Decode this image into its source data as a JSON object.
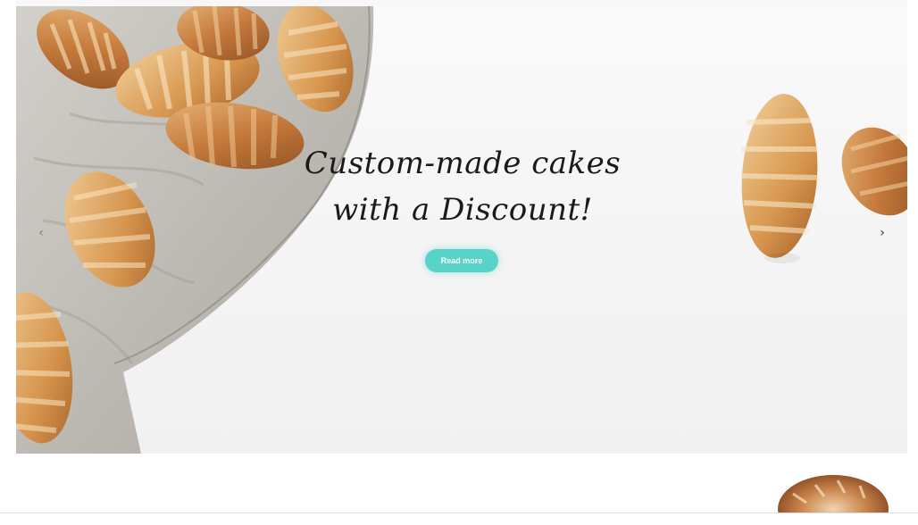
{
  "hero": {
    "headline_line1": "Custom-made cakes",
    "headline_line2": "with a Discount!",
    "cta_label": "Read more",
    "prev_arrow": "‹",
    "next_arrow": "›"
  },
  "colors": {
    "accent": "#58d3c8",
    "headline": "#1a1a1a",
    "background": "#f4f4f4"
  },
  "icons": {
    "prev": "chevron-left-icon",
    "next": "chevron-right-icon"
  }
}
